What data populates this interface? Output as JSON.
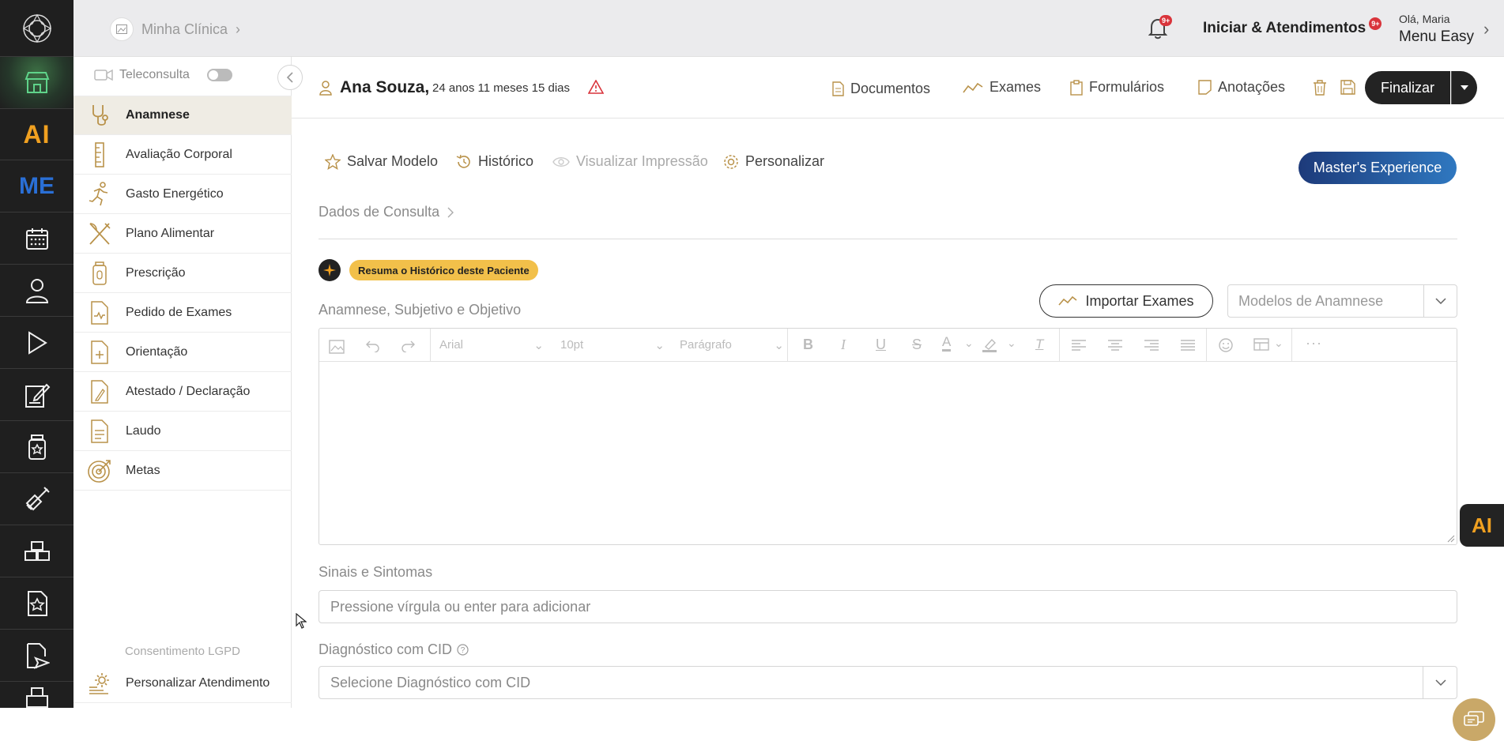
{
  "topbar": {
    "clinic_label": "Minha Clínica",
    "notif_badge": "9+",
    "start_label": "Iniciar & Atendimentos",
    "start_badge": "9+",
    "greeting": "Olá, Maria",
    "user_name": "Menu Easy"
  },
  "rail": {
    "items": [
      "logo-icon",
      "store-icon",
      "ai-icon",
      "me-icon",
      "calendar-icon",
      "patient-icon",
      "play-icon",
      "edit-document-icon",
      "medicine-bottle-icon",
      "syringe-icon",
      "boxes-icon",
      "star-document-icon",
      "send-document-icon",
      "more-icon"
    ],
    "ai_label": "AI",
    "me_label": "ME"
  },
  "sidebar": {
    "teleconsulta_label": "Teleconsulta",
    "teleconsulta_on": false,
    "items": [
      {
        "label": "Anamnese",
        "icon": "stethoscope-icon",
        "active": true
      },
      {
        "label": "Avaliação Corporal",
        "icon": "ruler-icon",
        "active": false
      },
      {
        "label": "Gasto Energético",
        "icon": "running-icon",
        "active": false
      },
      {
        "label": "Plano Alimentar",
        "icon": "cutlery-icon",
        "active": false
      },
      {
        "label": "Prescrição",
        "icon": "prescription-icon",
        "active": false
      },
      {
        "label": "Pedido de Exames",
        "icon": "exam-request-icon",
        "active": false
      },
      {
        "label": "Orientação",
        "icon": "orientation-icon",
        "active": false
      },
      {
        "label": "Atestado / Declaração",
        "icon": "certificate-icon",
        "active": false
      },
      {
        "label": "Laudo",
        "icon": "report-icon",
        "active": false
      },
      {
        "label": "Metas",
        "icon": "target-icon",
        "active": false
      }
    ],
    "lgpd_label": "Consentimento LGPD",
    "customize_label": "Personalizar Atendimento"
  },
  "patient": {
    "name": "Ana Souza,",
    "age": "24 anos 11 meses 15 dias"
  },
  "header_actions": {
    "documents": "Documentos",
    "exams": "Exames",
    "forms": "Formulários",
    "notes": "Anotações",
    "finish": "Finalizar"
  },
  "toolbar": {
    "save_model": "Salvar Modelo",
    "history": "Histórico",
    "print_preview": "Visualizar Impressão",
    "customize": "Personalizar",
    "masters": "Master's Experience"
  },
  "section": {
    "breadcrumb": "Dados de Consulta",
    "ai_summary": "Resuma o Histórico deste Paciente",
    "anamnese_label": "Anamnese, Subjetivo e Objetivo",
    "import_exams": "Importar Exames",
    "models_placeholder": "Modelos de Anamnese"
  },
  "editor_toolbar": {
    "font": "Arial",
    "size": "10pt",
    "block": "Parágrafo"
  },
  "fields": {
    "symptoms_label": "Sinais e Sintomas",
    "symptoms_placeholder": "Pressione vírgula ou enter para adicionar",
    "cid_label": "Diagnóstico com CID",
    "cid_placeholder": "Selecione Diagnóstico com CID"
  },
  "floating": {
    "ai_label": "AI"
  },
  "colors": {
    "accent_gold": "#b9924a",
    "ai_orange": "#f0a020",
    "me_blue": "#2a6fd6",
    "dark": "#1f1f1f",
    "badge_red": "#d9343b",
    "master_grad_start": "#1d3a7a",
    "master_grad_end": "#2f78c0"
  }
}
